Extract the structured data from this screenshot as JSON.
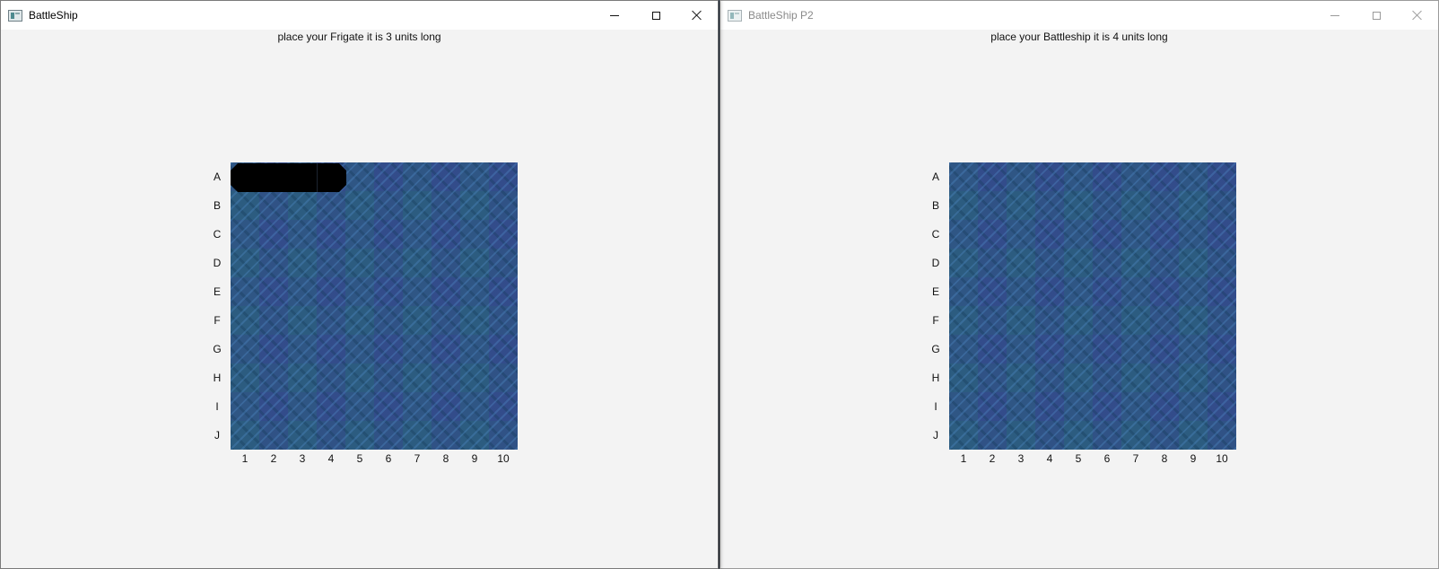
{
  "windows": [
    {
      "title": "BattleShip",
      "prompt": "place your Frigate it is 3 units long",
      "active": true
    },
    {
      "title": "BattleShip P2",
      "prompt": "place your Battleship it is 4 units long",
      "active": false
    }
  ],
  "grid": {
    "rows": [
      "A",
      "B",
      "C",
      "D",
      "E",
      "F",
      "G",
      "H",
      "I",
      "J"
    ],
    "cols": [
      "1",
      "2",
      "3",
      "4",
      "5",
      "6",
      "7",
      "8",
      "9",
      "10"
    ]
  },
  "placed_ship": {
    "window": "BattleShip",
    "row": "A",
    "cols": [
      "1",
      "2",
      "3",
      "4"
    ],
    "color": "#000000"
  },
  "window_controls": [
    "minimize-icon",
    "maximize-icon",
    "close-icon"
  ],
  "colors": {
    "window_bg": "#f3f3f3",
    "titlebar_bg": "#ffffff",
    "water": "#2f4f86"
  }
}
